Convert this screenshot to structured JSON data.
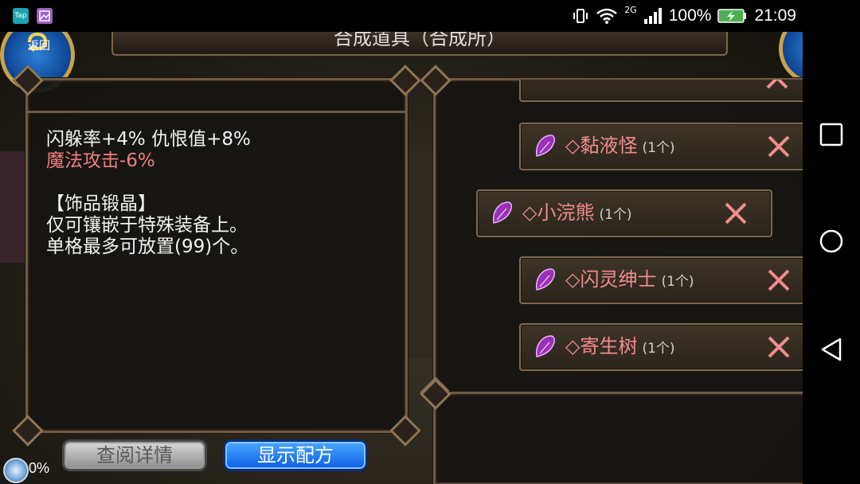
{
  "status_bar": {
    "app_icons": [
      "Tap",
      "gallery-app-icon"
    ],
    "network": "2G",
    "battery": "100%",
    "time": "21:09"
  },
  "game": {
    "title": "合成道具（合成所）",
    "back_label": "返回",
    "description": {
      "line1": "闪躲率+4% 仇恨值+8%",
      "line2": "魔法攻击-6%",
      "line3": "【饰品锻晶】",
      "line4": "仅可镶嵌于特殊装备上。",
      "line5": "单格最多可放置(99)个。"
    },
    "list_items": [
      {
        "name": "◇黏液怪",
        "count": "(1个)"
      },
      {
        "name": "◇小浣熊",
        "count": "(1个)"
      },
      {
        "name": "◇闪灵绅士",
        "count": "(1个)"
      },
      {
        "name": "◇寄生树",
        "count": "(1个)"
      }
    ],
    "buttons": {
      "view_details": "查阅详情",
      "show_recipe": "显示配方"
    },
    "loading_percent": "0%"
  },
  "colors": {
    "accent_red": "#f08c8c",
    "button_blue": "#1a73f0",
    "frame_border": "#6f5a42"
  }
}
